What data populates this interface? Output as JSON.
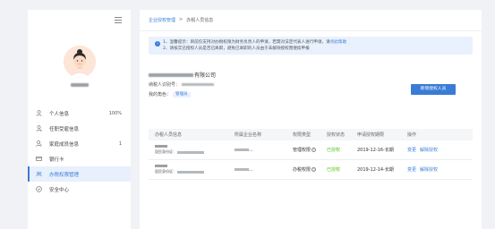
{
  "sidebar": {
    "items": [
      {
        "label": "个人信息",
        "count": "100%"
      },
      {
        "label": "任职受雇信息",
        "count": ""
      },
      {
        "label": "家庭成员信息",
        "count": "1"
      },
      {
        "label": "银行卡",
        "count": ""
      },
      {
        "label": "办税权限管理",
        "count": "",
        "active": true
      },
      {
        "label": "安全中心",
        "count": ""
      }
    ]
  },
  "breadcrumb": {
    "parent": "企业授权管理",
    "separator": ">",
    "current": "办税人员信息"
  },
  "notice": {
    "line1": "1、温馨提示：目前仅支持对办税权限为财务负责人的申请，若需对法定代表人进行申请，请",
    "line1_link": "点此帮助",
    "line2": "2、请核实已授权人员是否已离职，避免已离职的人员由于未解除授权而继续申报"
  },
  "company": {
    "name_suffix": "有限公司",
    "taxid_label": "纳税人识别号：",
    "role_label": "我的角色：",
    "role_value": "管理员"
  },
  "add_button": "新增授权人员",
  "table": {
    "headers": [
      "办税人员信息",
      "所属企业名称",
      "权限类型",
      "授权状态",
      "申请授权期限",
      "操作"
    ],
    "rows": [
      {
        "id_label": "居民身份证：",
        "company_suffix": "...",
        "perm_type": "管理权限",
        "status": "已授权",
        "period": "2019-12-16-长期",
        "op1": "变更",
        "op2": "解除授权"
      },
      {
        "id_label": "居民身份证：",
        "company_suffix": "...",
        "perm_type": "办税权限",
        "status": "已授权",
        "period": "2019-12-14-长期",
        "op1": "变更",
        "op2": "解除授权"
      }
    ]
  },
  "colors": {
    "accent": "#3a7bd5",
    "success": "#52c41a",
    "notice_bg": "#e8f1fd"
  }
}
